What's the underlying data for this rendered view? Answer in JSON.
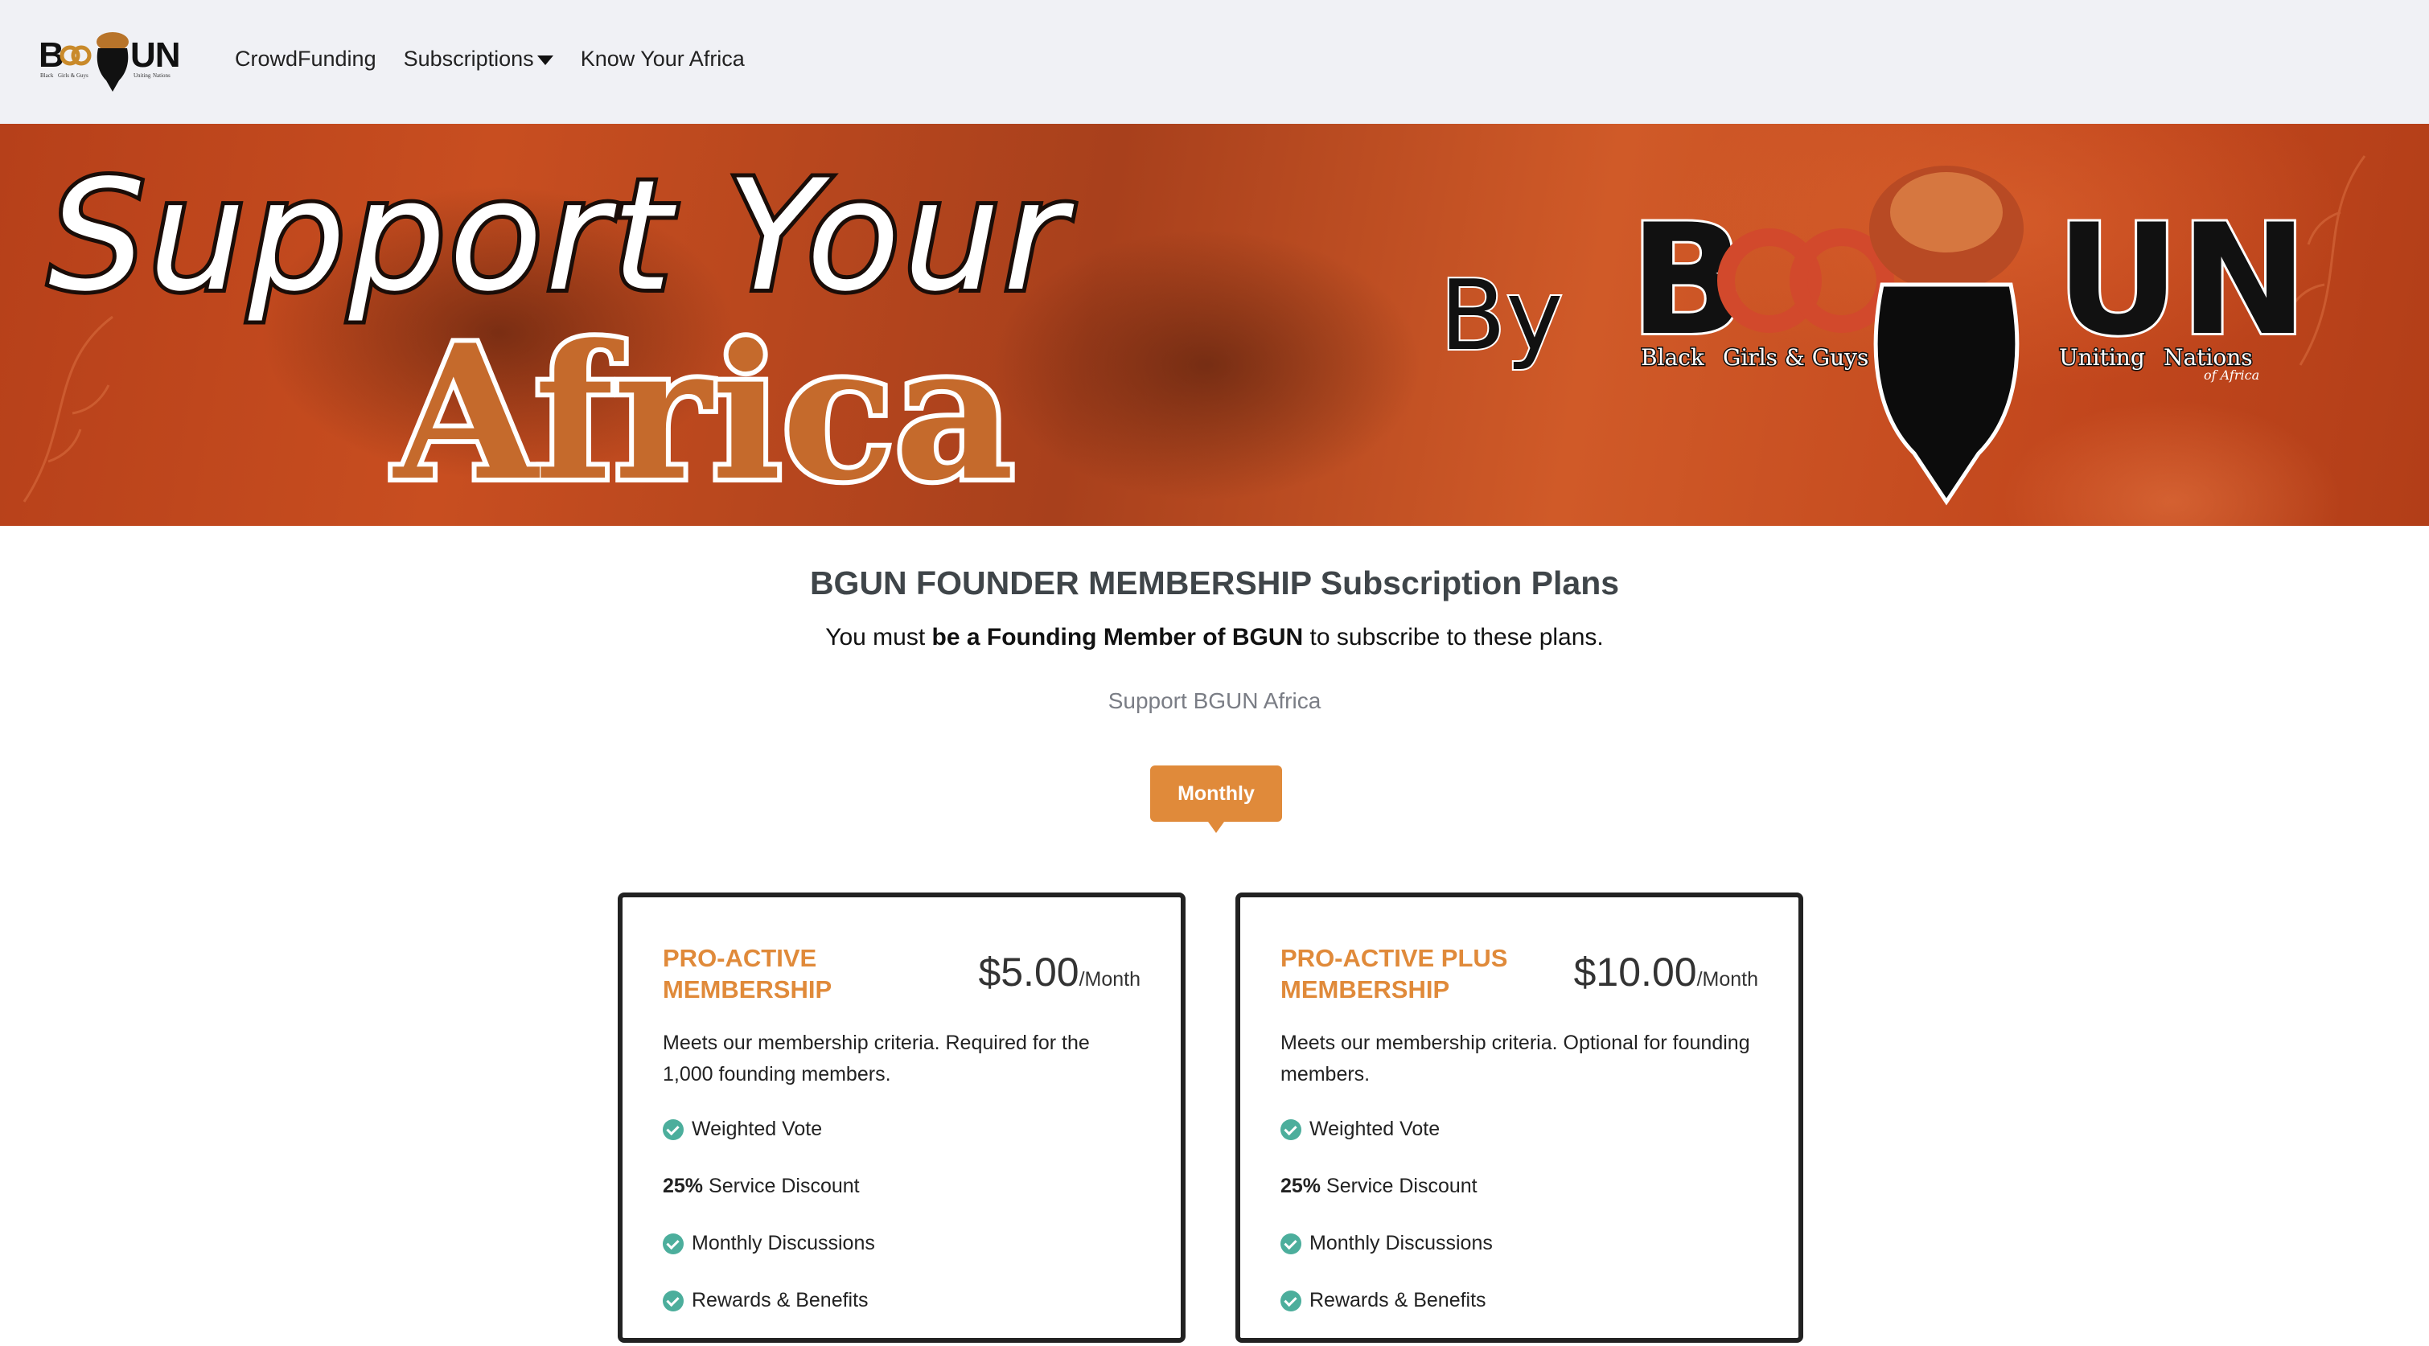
{
  "navbar": {
    "logo": {
      "name": "BGGUN logo",
      "icon": "bggun-logo",
      "letters_left": "B",
      "letters_right": "UN",
      "tiny_text": [
        "Black",
        "Girls & Guys",
        "Uniting",
        "Nations"
      ]
    },
    "links": [
      {
        "label": "CrowdFunding"
      },
      {
        "label": "Subscriptions",
        "has_caret": true
      },
      {
        "label": "Know Your Africa"
      }
    ]
  },
  "hero": {
    "line1": "Support Your",
    "line2": "Africa",
    "by": "By",
    "brand_left": "B",
    "brand_right": "UN",
    "brand_words": [
      "Black",
      "Girls & Guys",
      "Uniting",
      "Nations"
    ],
    "brand_sub": "of Africa"
  },
  "main": {
    "title": "BGUN FOUNDER MEMBERSHIP Subscription Plans",
    "subtitle_prefix": "You must ",
    "subtitle_bold": "be a Founding Member of BGUN",
    "subtitle_suffix": " to subscribe to these plans.",
    "support_text": "Support BGUN Africa",
    "billing_toggle": "Monthly"
  },
  "plans": [
    {
      "name_line1": "PRO-ACTIVE",
      "name_line2": "MEMBERSHIP",
      "price": "$5.00",
      "period": "/Month",
      "description": "Meets our membership criteria. Required for the 1,000 founding members.",
      "features": [
        {
          "type": "check",
          "text": "Weighted Vote"
        },
        {
          "type": "bold",
          "bold": "25%",
          "text": "Service Discount"
        },
        {
          "type": "check",
          "text": "Monthly Discussions"
        },
        {
          "type": "check",
          "text": "Rewards & Benefits"
        }
      ]
    },
    {
      "name_line1": "PRO-ACTIVE PLUS",
      "name_line2": "MEMBERSHIP",
      "price": "$10.00",
      "period": "/Month",
      "description": "Meets our membership criteria. Optional for founding members.",
      "features": [
        {
          "type": "check",
          "text": "Weighted Vote"
        },
        {
          "type": "bold",
          "bold": "25%",
          "text": "Service Discount"
        },
        {
          "type": "check",
          "text": "Monthly Discussions"
        },
        {
          "type": "check",
          "text": "Rewards & Benefits"
        }
      ]
    }
  ],
  "colors": {
    "accent": "#e08a3a",
    "check": "#4cae9c",
    "navbar_bg": "#f0f1f5",
    "card_border": "#222222"
  }
}
